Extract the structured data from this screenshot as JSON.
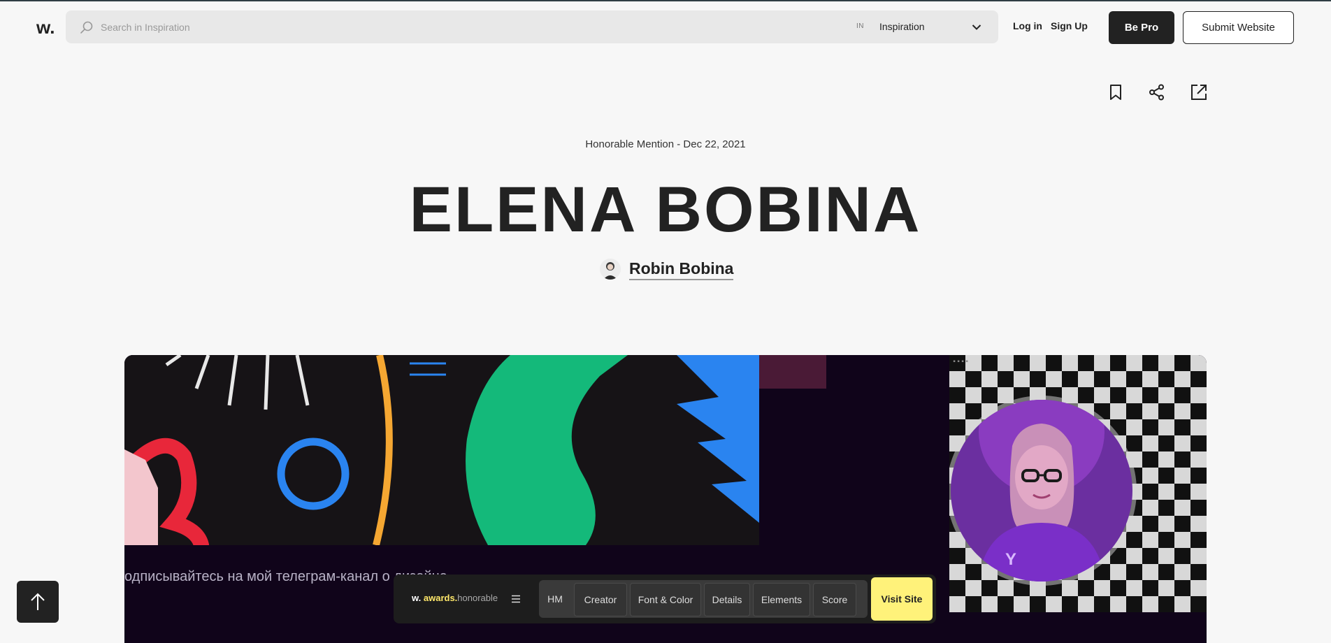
{
  "header": {
    "logo": "w.",
    "search_placeholder": "Search in Inspiration",
    "search_in_label": "IN",
    "search_scope": "Inspiration",
    "login": "Log in",
    "signup": "Sign Up",
    "be_pro": "Be Pro",
    "submit_website": "Submit Website"
  },
  "toolbar": {
    "icons": [
      "bookmark-icon",
      "share-icon",
      "external-link-icon"
    ]
  },
  "page": {
    "meta": "Honorable Mention - Dec 22, 2021",
    "title": "ELENA BOBINA",
    "author": "Robin Bobina"
  },
  "hero": {
    "overlay_text": "одписывайтесь на мой телеграм-канал о дизайне",
    "colors": {
      "background": "#10041a",
      "green": "#14b97a",
      "blue": "#2a84f0",
      "orange": "#f5a732",
      "red": "#e8273a",
      "purple": "#9b3cd6"
    }
  },
  "awards_bar": {
    "brand_w": "w.",
    "brand_awards": "awards.",
    "brand_level": "honorable",
    "tabs": [
      "HM",
      "Creator",
      "Font & Color",
      "Details",
      "Elements",
      "Score"
    ],
    "visit_site": "Visit Site"
  }
}
